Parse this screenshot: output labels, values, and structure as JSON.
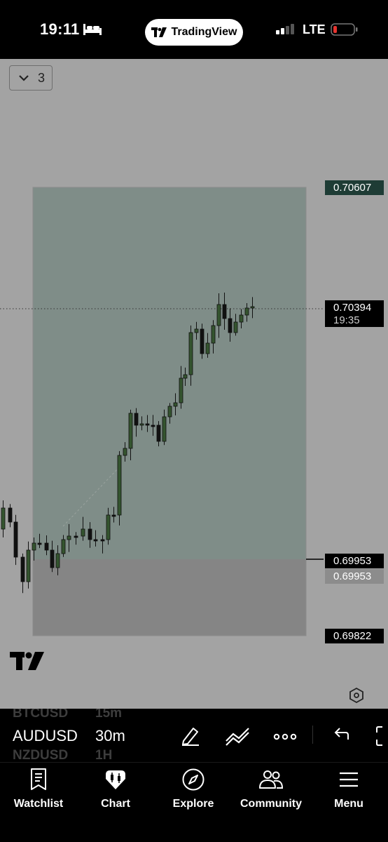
{
  "status_bar": {
    "time": "19:11",
    "app_pill": "TradingView",
    "network": "LTE",
    "icons": [
      "bed-icon",
      "signal-icon",
      "battery-low-icon"
    ]
  },
  "chart": {
    "layout_count": "3",
    "background": "#a3a3a3",
    "zone_upper_color": "#7f8d88",
    "zone_lower_color": "#858585",
    "candle_up_color": "#34542f",
    "candle_down_color": "#111111",
    "price_labels": {
      "target": "0.70607",
      "current": "0.70394",
      "countdown": "19:35",
      "entry": "0.69953",
      "entry_dup": "0.69953",
      "stop": "0.69822"
    }
  },
  "symbol_bar": {
    "symbol_prev": "BTCUSD",
    "timeframe_prev": "15m",
    "symbol": "AUDUSD",
    "timeframe": "30m",
    "symbol_next": "NZDUSD",
    "timeframe_next": "1H"
  },
  "bottom_nav": {
    "watchlist": "Watchlist",
    "chart": "Chart",
    "explore": "Explore",
    "community": "Community",
    "menu": "Menu"
  }
}
